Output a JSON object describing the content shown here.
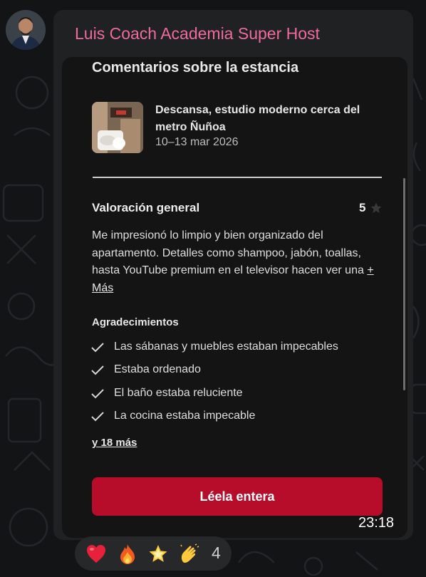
{
  "chat": {
    "sender_name": "Luis Coach Academia Super Host",
    "timestamp": "23:18"
  },
  "review_card": {
    "title": "Comentarios sobre la estancia",
    "listing": {
      "name": "Descansa, estudio moderno cerca del metro Ñuñoa",
      "dates": "10–13 mar 2026"
    },
    "rating": {
      "label": "Valoración general",
      "value": "5",
      "icon": "star-icon"
    },
    "comment": "Me impresionó lo limpio y bien organizado del apartamento. Detalles como shampoo, jabón, toallas, hasta YouTube premium en el televisor hacen ver una",
    "more_label": "+ Más",
    "thanks": {
      "title": "Agradecimientos",
      "items": [
        "Las sábanas y muebles estaban impecables",
        "Estaba ordenado",
        "El baño estaba reluciente",
        "La cocina estaba impecable"
      ],
      "more_label": "y 18 más"
    },
    "button_label": "Léela entera"
  },
  "reactions": {
    "emojis": [
      "red-heart",
      "fire",
      "glowing-star",
      "clapping-hands"
    ],
    "count": "4"
  },
  "colors": {
    "sender": "#f06b9c",
    "button": "#b80d2a",
    "bubble": "#202123",
    "card": "#141414"
  }
}
